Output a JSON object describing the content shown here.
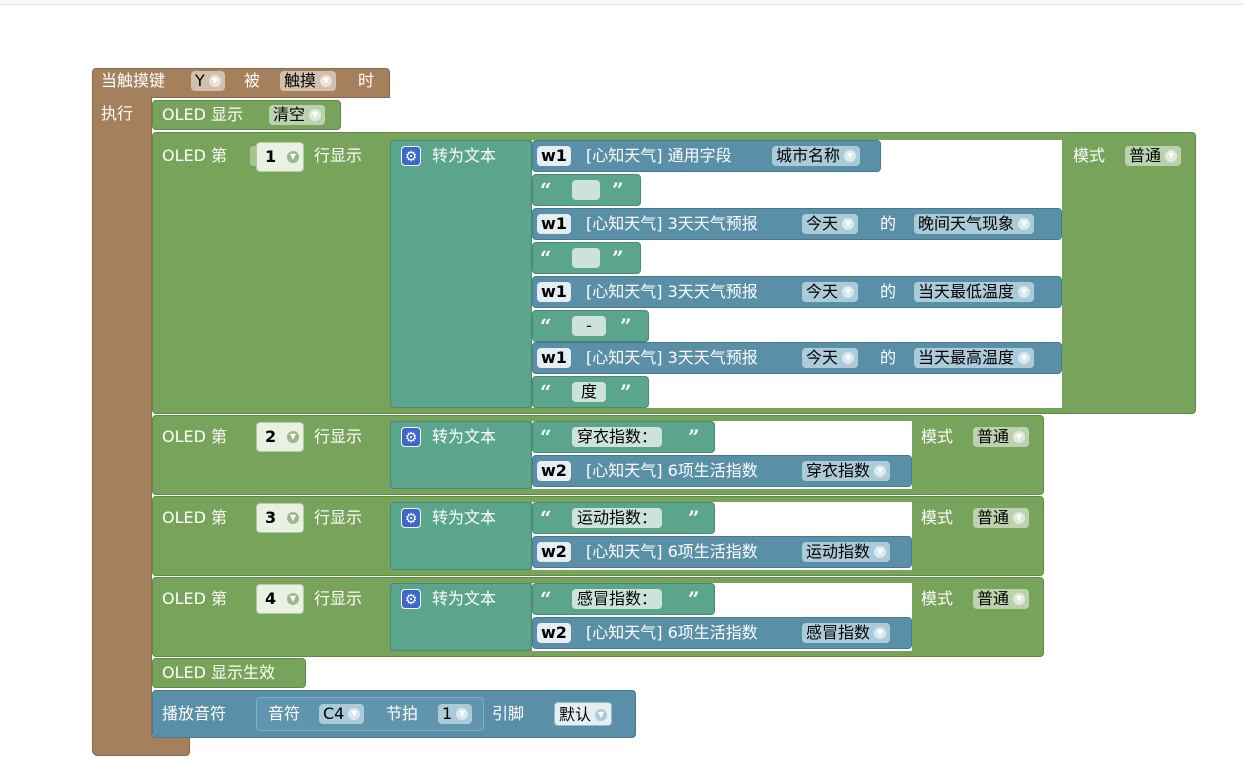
{
  "event": {
    "prefix": "当触摸键",
    "key": "Y",
    "mid": "被",
    "action": "触摸",
    "suffix": "时",
    "do_label": "执行"
  },
  "oled_clear": {
    "label": "OLED 显示",
    "option": "清空"
  },
  "rows": [
    {
      "prefix": "OLED 第",
      "line": "1",
      "mid": "行显示",
      "convert": "转为文本",
      "mode_label": "模式",
      "mode": "普通",
      "items": [
        {
          "kind": "weather",
          "tag": "w1",
          "text": "[心知天气] 通用字段",
          "opt1": "城市名称"
        },
        {
          "kind": "string",
          "value": ""
        },
        {
          "kind": "forecast",
          "tag": "w1",
          "text": "[心知天气] 3天天气预报",
          "day": "今天",
          "of": "的",
          "field": "晚间天气现象"
        },
        {
          "kind": "string",
          "value": ""
        },
        {
          "kind": "forecast",
          "tag": "w1",
          "text": "[心知天气] 3天天气预报",
          "day": "今天",
          "of": "的",
          "field": "当天最低温度"
        },
        {
          "kind": "string",
          "value": "-"
        },
        {
          "kind": "forecast",
          "tag": "w1",
          "text": "[心知天气] 3天天气预报",
          "day": "今天",
          "of": "的",
          "field": "当天最高温度"
        },
        {
          "kind": "string",
          "value": "度"
        }
      ]
    },
    {
      "prefix": "OLED 第",
      "line": "2",
      "mid": "行显示",
      "convert": "转为文本",
      "mode_label": "模式",
      "mode": "普通",
      "str": "穿衣指数：",
      "tag": "w2",
      "text": "[心知天气] 6项生活指数",
      "opt": "穿衣指数"
    },
    {
      "prefix": "OLED 第",
      "line": "3",
      "mid": "行显示",
      "convert": "转为文本",
      "mode_label": "模式",
      "mode": "普通",
      "str": "运动指数：",
      "tag": "w2",
      "text": "[心知天气] 6项生活指数",
      "opt": "运动指数"
    },
    {
      "prefix": "OLED 第",
      "line": "4",
      "mid": "行显示",
      "convert": "转为文本",
      "mode_label": "模式",
      "mode": "普通",
      "str": "感冒指数：",
      "tag": "w2",
      "text": "[心知天气] 6项生活指数",
      "opt": "感冒指数"
    }
  ],
  "oled_apply": {
    "label": "OLED 显示生效"
  },
  "tone": {
    "label": "播放音符",
    "note_label": "音符",
    "note": "C4",
    "beat_label": "节拍",
    "beat": "1",
    "pin_label": "引脚",
    "pin": "默认"
  },
  "icons": {
    "convert": "gear-icon",
    "dropdown": "chevron-down-icon"
  },
  "colors": {
    "event": "#a5805c",
    "oled": "#78a35b",
    "text": "#5ba58c",
    "weather": "#5a8fa8"
  }
}
